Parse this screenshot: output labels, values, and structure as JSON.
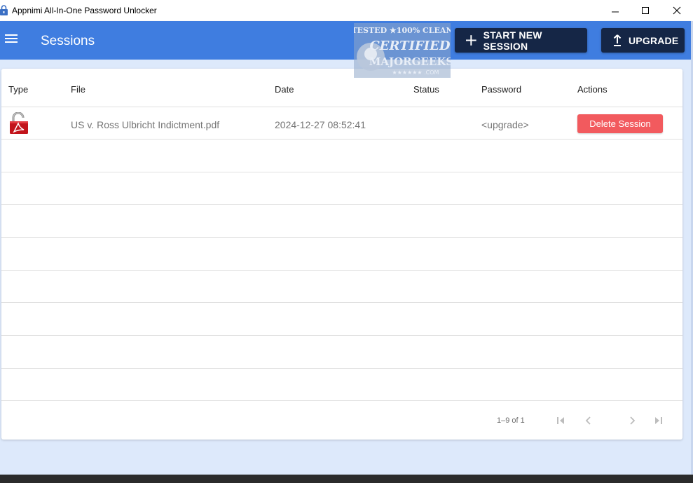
{
  "window": {
    "title": "Appnimi All-In-One Password Unlocker",
    "icon": "lock-icon"
  },
  "appbar": {
    "title": "Sessions",
    "start_button": "START NEW SESSION",
    "upgrade_button": "UPGRADE",
    "accent_color": "#3f7de0",
    "button_color": "#152646"
  },
  "watermark": {
    "line1": "TESTED ★100% CLEAN",
    "line2": "CERTIFIED",
    "line3": "MAJORGEEKS",
    "line4": "★★★★★★ .COM"
  },
  "table": {
    "columns": [
      "Type",
      "File",
      "Date",
      "Status",
      "Password",
      "Actions"
    ],
    "rows": [
      {
        "type_icon": "pdf-lock-icon",
        "file": "US v. Ross Ulbricht Indictment.pdf",
        "date": "2024-12-27 08:52:41",
        "status": "",
        "password": "<upgrade>",
        "action": "Delete Session"
      }
    ],
    "delete_color": "#f25a5e"
  },
  "pagination": {
    "text": "1–9 of 1"
  }
}
